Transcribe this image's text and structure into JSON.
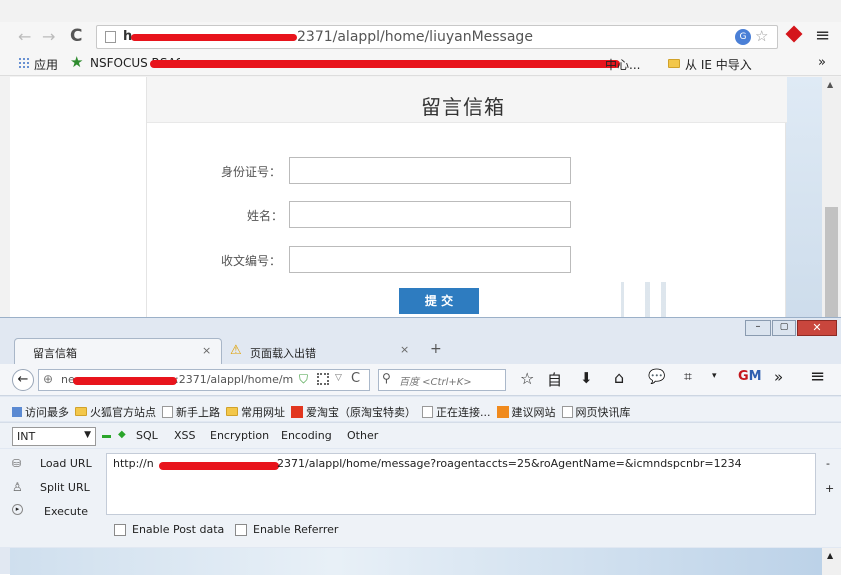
{
  "chrome_top": {
    "url": "2371/alappl/home/liuyanMessage",
    "url_prefix": "h",
    "bookmarks": {
      "apps": "应用",
      "nsfocus": "NSFOCUS RSAS",
      "more": "中心...",
      "ie_import": "从 IE 中导入"
    },
    "more_btn": "»"
  },
  "page": {
    "title": "留言信箱",
    "fields": [
      {
        "label": "身份证号：",
        "value": ""
      },
      {
        "label": "姓名：",
        "value": ""
      },
      {
        "label": "收文编号：",
        "value": ""
      }
    ],
    "submit": "提 交"
  },
  "firefox": {
    "tabs": [
      {
        "label": "留言信箱"
      },
      {
        "label": "页面载入出错"
      }
    ],
    "new_tab": "+",
    "url": ":2371/alappl/home/m",
    "url_prefix": "ne",
    "search_placeholder": "百度 <Ctrl+K>",
    "bookmarks": [
      "访问最多",
      "火狐官方站点",
      "新手上路",
      "常用网址",
      "爱淘宝（原淘宝特卖）",
      "正在连接...",
      "建议网站",
      "网页快讯库"
    ],
    "hackbar": {
      "select": "INT",
      "menus": [
        "SQL",
        "XSS",
        "Encryption",
        "Encoding",
        "Other"
      ],
      "load_url": "Load URL",
      "split_url": "Split URL",
      "execute": "Execute",
      "url_prefix": "http://n",
      "url_value": "2371/alappl/home/message?roagentaccts=25&roAgentName=&icmndspcnbr=1234",
      "enable_post": "Enable Post data",
      "enable_referrer": "Enable Referrer"
    }
  },
  "colors": {
    "submit_bg": "#2e7cc0",
    "redaction": "#e8141c"
  }
}
